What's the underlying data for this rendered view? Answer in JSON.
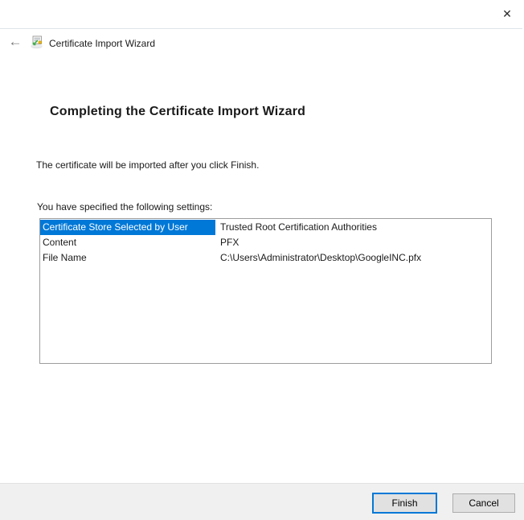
{
  "window": {
    "close_glyph": "✕",
    "title": "Certificate Import Wizard",
    "back_glyph": "←"
  },
  "main": {
    "heading": "Completing the Certificate Import Wizard",
    "description": "The certificate will be imported after you click Finish.",
    "settings_label": "You have specified the following settings:",
    "settings": [
      {
        "name": "Certificate Store Selected by User",
        "value": "Trusted Root Certification Authorities",
        "selected": true
      },
      {
        "name": "Content",
        "value": "PFX",
        "selected": false
      },
      {
        "name": "File Name",
        "value": "C:\\Users\\Administrator\\Desktop\\GoogleINC.pfx",
        "selected": false
      }
    ]
  },
  "footer": {
    "finish_label": "Finish",
    "cancel_label": "Cancel"
  },
  "colors": {
    "selection_bg": "#0078d7",
    "selection_text": "#ffffff",
    "default_button_border": "#0078d7",
    "button_bg": "#e1e1e1",
    "footer_bg": "#f0f0f0"
  }
}
